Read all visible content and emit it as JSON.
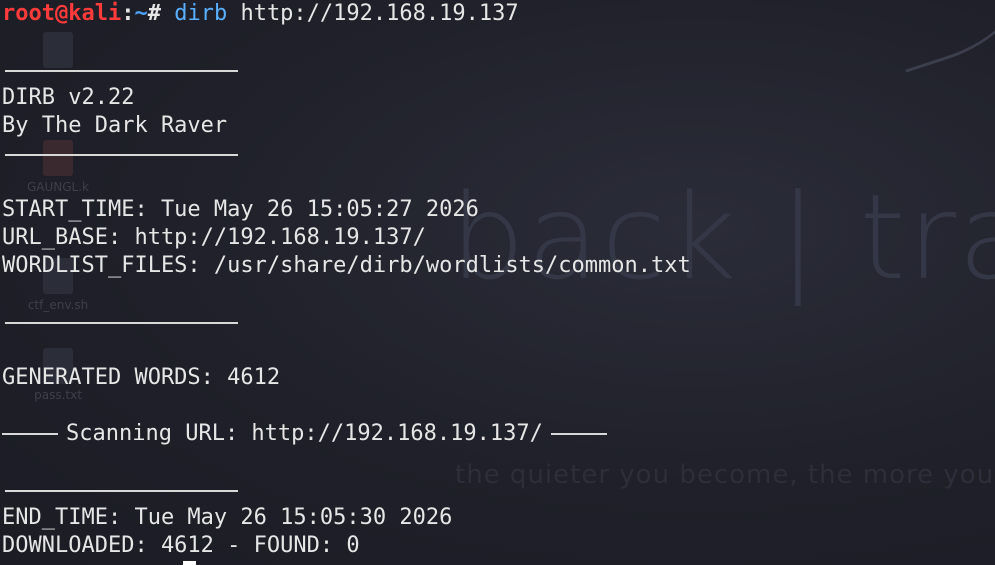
{
  "wallpaper": {
    "brand_text": "back | trac",
    "tagline_text": "the quieter you become, the more you are able to hear",
    "desktop_icons": [
      {
        "name": "",
        "glyph": "folder-icon"
      },
      {
        "name": "GAUNGL.k",
        "glyph": "file-icon"
      },
      {
        "name": "ctf_env.sh",
        "glyph": "script-icon"
      },
      {
        "name": "pass.txt",
        "glyph": "text-file-icon"
      }
    ]
  },
  "terminal": {
    "prompt": {
      "user_host": "root@kali",
      "colon": ":",
      "path": "~",
      "symbol": "# ",
      "command_name": "dirb",
      "command_args": " http://192.168.19.137"
    },
    "header": {
      "version": "DIRB v2.22",
      "author": "By The Dark Raver"
    },
    "info": {
      "start_time": "START_TIME: Tue May 26 15:05:27 2026",
      "url_base": "URL_BASE: http://192.168.19.137/",
      "wordlist_files": "WORDLIST_FILES: /usr/share/dirb/wordlists/common.txt"
    },
    "generated_words": "GENERATED WORDS: 4612",
    "scanning": "Scanning URL: http://192.168.19.137/",
    "end_time": "END_TIME: Tue May 26 15:05:30 2026",
    "downloaded": "DOWNLOADED: 4612 - FOUND: 0"
  },
  "colors": {
    "prompt_user": "#ff3b3b",
    "prompt_path": "#4ea3ff",
    "command": "#59b0ff",
    "text": "#e6e6e6",
    "background": "#1e1f29"
  }
}
